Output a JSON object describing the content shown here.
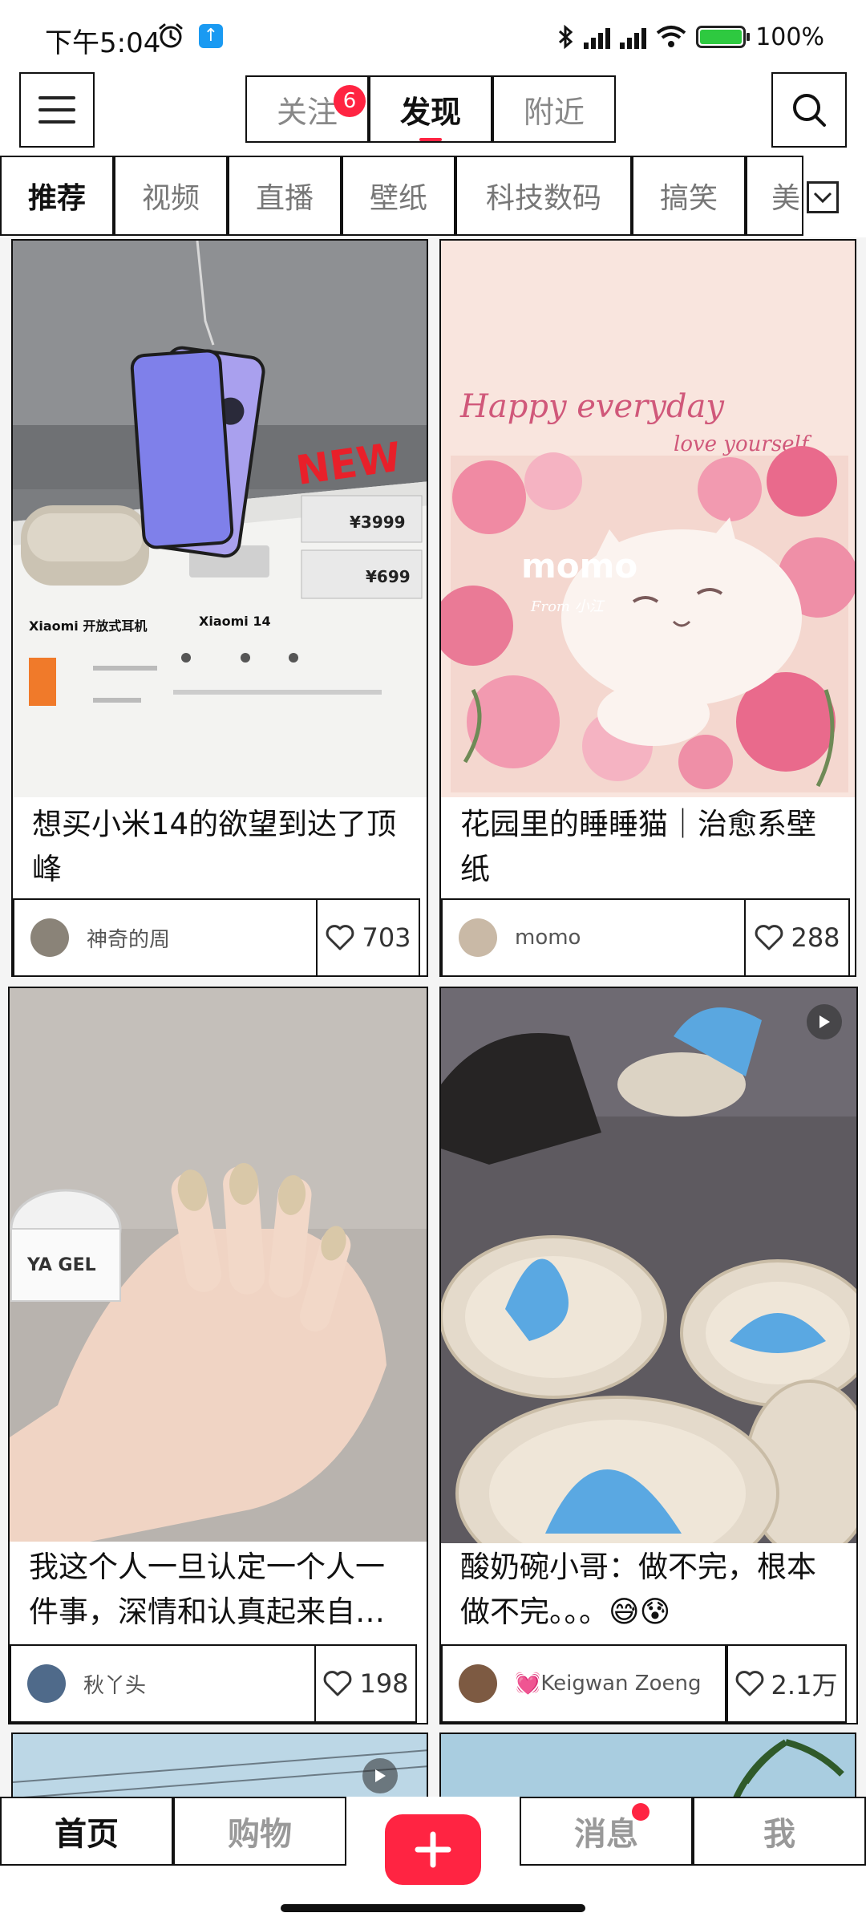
{
  "status_bar": {
    "time": "下午5:04",
    "battery": "100%"
  },
  "top_nav": {
    "tabs": [
      {
        "label": "关注",
        "badge": "6"
      },
      {
        "label": "发现"
      },
      {
        "label": "附近"
      }
    ]
  },
  "categories": [
    "推荐",
    "视频",
    "直播",
    "壁纸",
    "科技数码",
    "搞笑",
    "美"
  ],
  "feed": [
    {
      "title": "想买小米14的欲望到达了顶峰",
      "author": "神奇的周",
      "likes": "703"
    },
    {
      "title": "花园里的睡睡猫｜治愈系壁纸",
      "author": "momo",
      "likes": "288"
    },
    {
      "title": "我这个人一旦认定一个人一件事，深情和认真起来自…",
      "author": "秋丫头",
      "likes": "198"
    },
    {
      "title": "酸奶碗小哥：做不完，根本做不完。。。😅😰",
      "author": "💓Keigwan Zoeng",
      "likes": "2.1万"
    }
  ],
  "card_images": {
    "card1_screen_text": [
      "Xiaomi 开放式耳机",
      "Xiaomi 14",
      "¥3999",
      "¥699",
      "NEW"
    ],
    "card2_screen_text": [
      "Happy everyday",
      "love yourself",
      "momo",
      "From 小江"
    ],
    "card3_screen_text": [
      "YA GEL"
    ]
  },
  "bottom_nav": {
    "tabs": [
      {
        "label": "首页"
      },
      {
        "label": "购物"
      },
      {
        "label": "消息"
      },
      {
        "label": "我"
      }
    ]
  },
  "colors": {
    "accent": "#ff2442",
    "text": "#111111",
    "muted": "#888888"
  }
}
